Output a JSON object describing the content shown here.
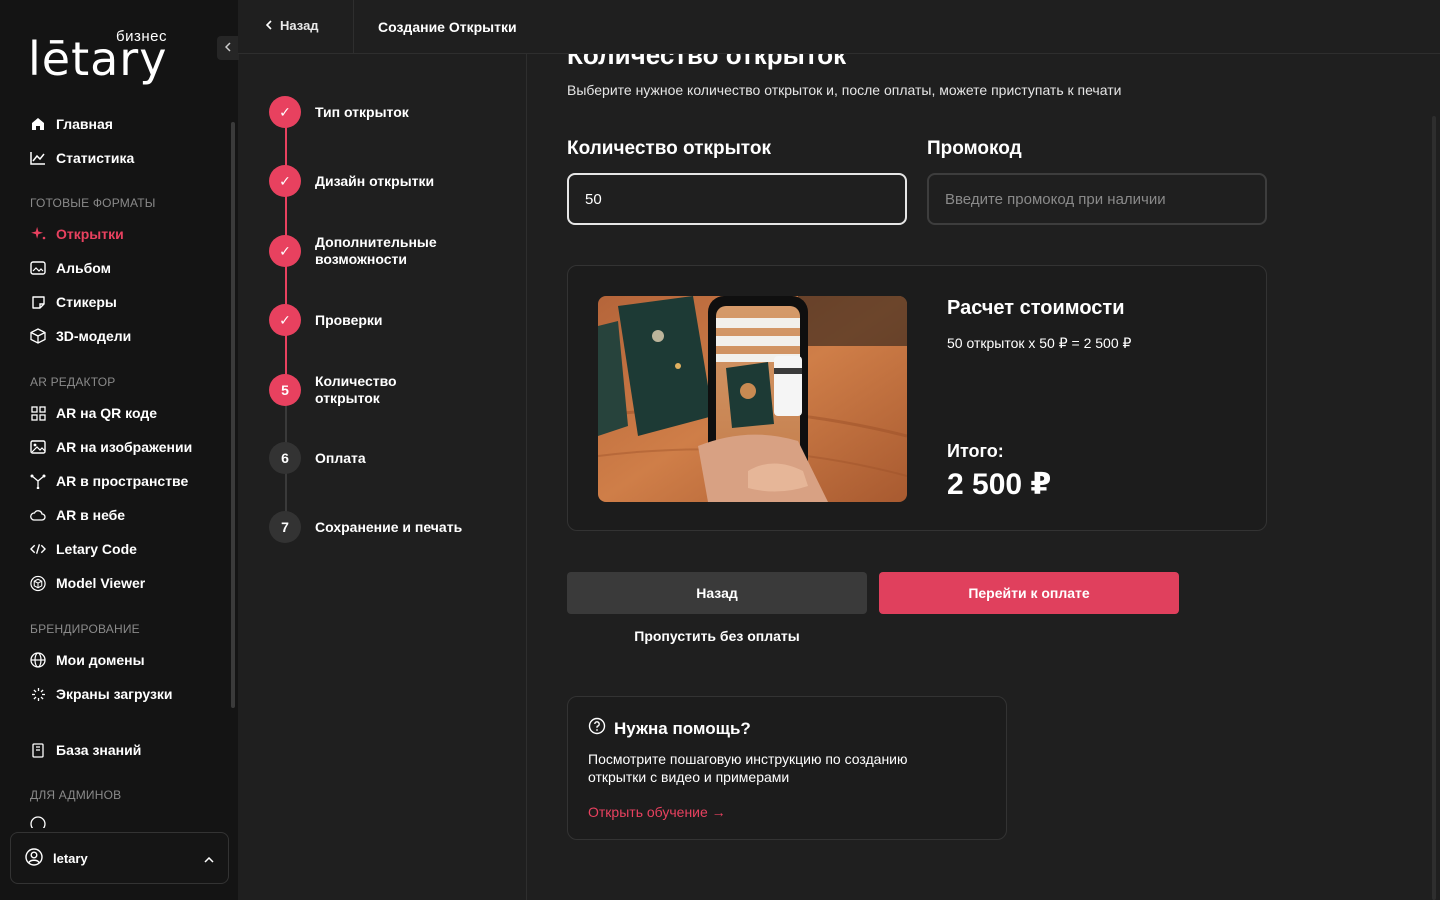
{
  "sidebar": {
    "logo_sub": "бизнес",
    "logo_main": "lētary",
    "nav_main": [
      {
        "label": "Главная",
        "icon": "home-icon"
      },
      {
        "label": "Статистика",
        "icon": "chart-line-icon"
      }
    ],
    "section_formats": "ГОТОВЫЕ ФОРМАТЫ",
    "nav_formats": [
      {
        "label": "Открытки",
        "icon": "sparkle-icon",
        "active": true
      },
      {
        "label": "Альбом",
        "icon": "album-icon"
      },
      {
        "label": "Стикеры",
        "icon": "sticker-icon"
      },
      {
        "label": "3D-модели",
        "icon": "cube-icon"
      }
    ],
    "section_ar": "AR РЕДАКТОР",
    "nav_ar": [
      {
        "label": "AR на QR коде",
        "icon": "qr-icon"
      },
      {
        "label": "AR на изображении",
        "icon": "image-icon"
      },
      {
        "label": "AR в пространстве",
        "icon": "space-icon"
      },
      {
        "label": "AR в небе",
        "icon": "cloud-icon"
      },
      {
        "label": "Letary Code",
        "icon": "code-icon"
      },
      {
        "label": "Model Viewer",
        "icon": "model-viewer-icon"
      }
    ],
    "section_brand": "БРЕНДИРОВАНИЕ",
    "nav_brand": [
      {
        "label": "Мои домены",
        "icon": "globe-icon"
      },
      {
        "label": "Экраны загрузки",
        "icon": "loader-icon"
      }
    ],
    "nav_kb": {
      "label": "База знаний",
      "icon": "book-icon"
    },
    "section_admin": "ДЛЯ АДМИНОВ",
    "user_name": "letary"
  },
  "topbar": {
    "back_label": "Назад",
    "title": "Создание Открытки"
  },
  "stepper": [
    {
      "label": "Тип открыток",
      "status": "done",
      "marker": "✓"
    },
    {
      "label": "Дизайн открытки",
      "status": "done",
      "marker": "✓"
    },
    {
      "label": "Дополнительные возможности",
      "status": "done",
      "marker": "✓"
    },
    {
      "label": "Проверки",
      "status": "done",
      "marker": "✓"
    },
    {
      "label": "Количество открыток",
      "status": "current",
      "marker": "5"
    },
    {
      "label": "Оплата",
      "status": "todo",
      "marker": "6"
    },
    {
      "label": "Сохранение и печать",
      "status": "todo",
      "marker": "7"
    }
  ],
  "main": {
    "heading": "Количество открыток",
    "subtitle": "Выберите нужное количество открыток и, после оплаты, можете приступать к печати",
    "qty_label": "Количество открыток",
    "qty_value": "50",
    "promo_label": "Промокод",
    "promo_placeholder": "Введите промокод при наличии",
    "calc_title": "Расчет стоимости",
    "calc_formula": "50 открыток x 50 ₽ = 2 500 ₽",
    "total_label": "Итого:",
    "total_value": "2 500 ₽",
    "back_button": "Назад",
    "pay_button": "Перейти к оплате",
    "skip_link": "Пропустить без оплаты",
    "help_title": "Нужна помощь?",
    "help_text": "Посмотрите пошаговую инструкцию по созданию открытки с видео и примерами",
    "help_link": "Открыть обучение →"
  },
  "colors": {
    "accent": "#e8415f",
    "bg": "#1f1f1f",
    "sidebar": "#141414"
  }
}
